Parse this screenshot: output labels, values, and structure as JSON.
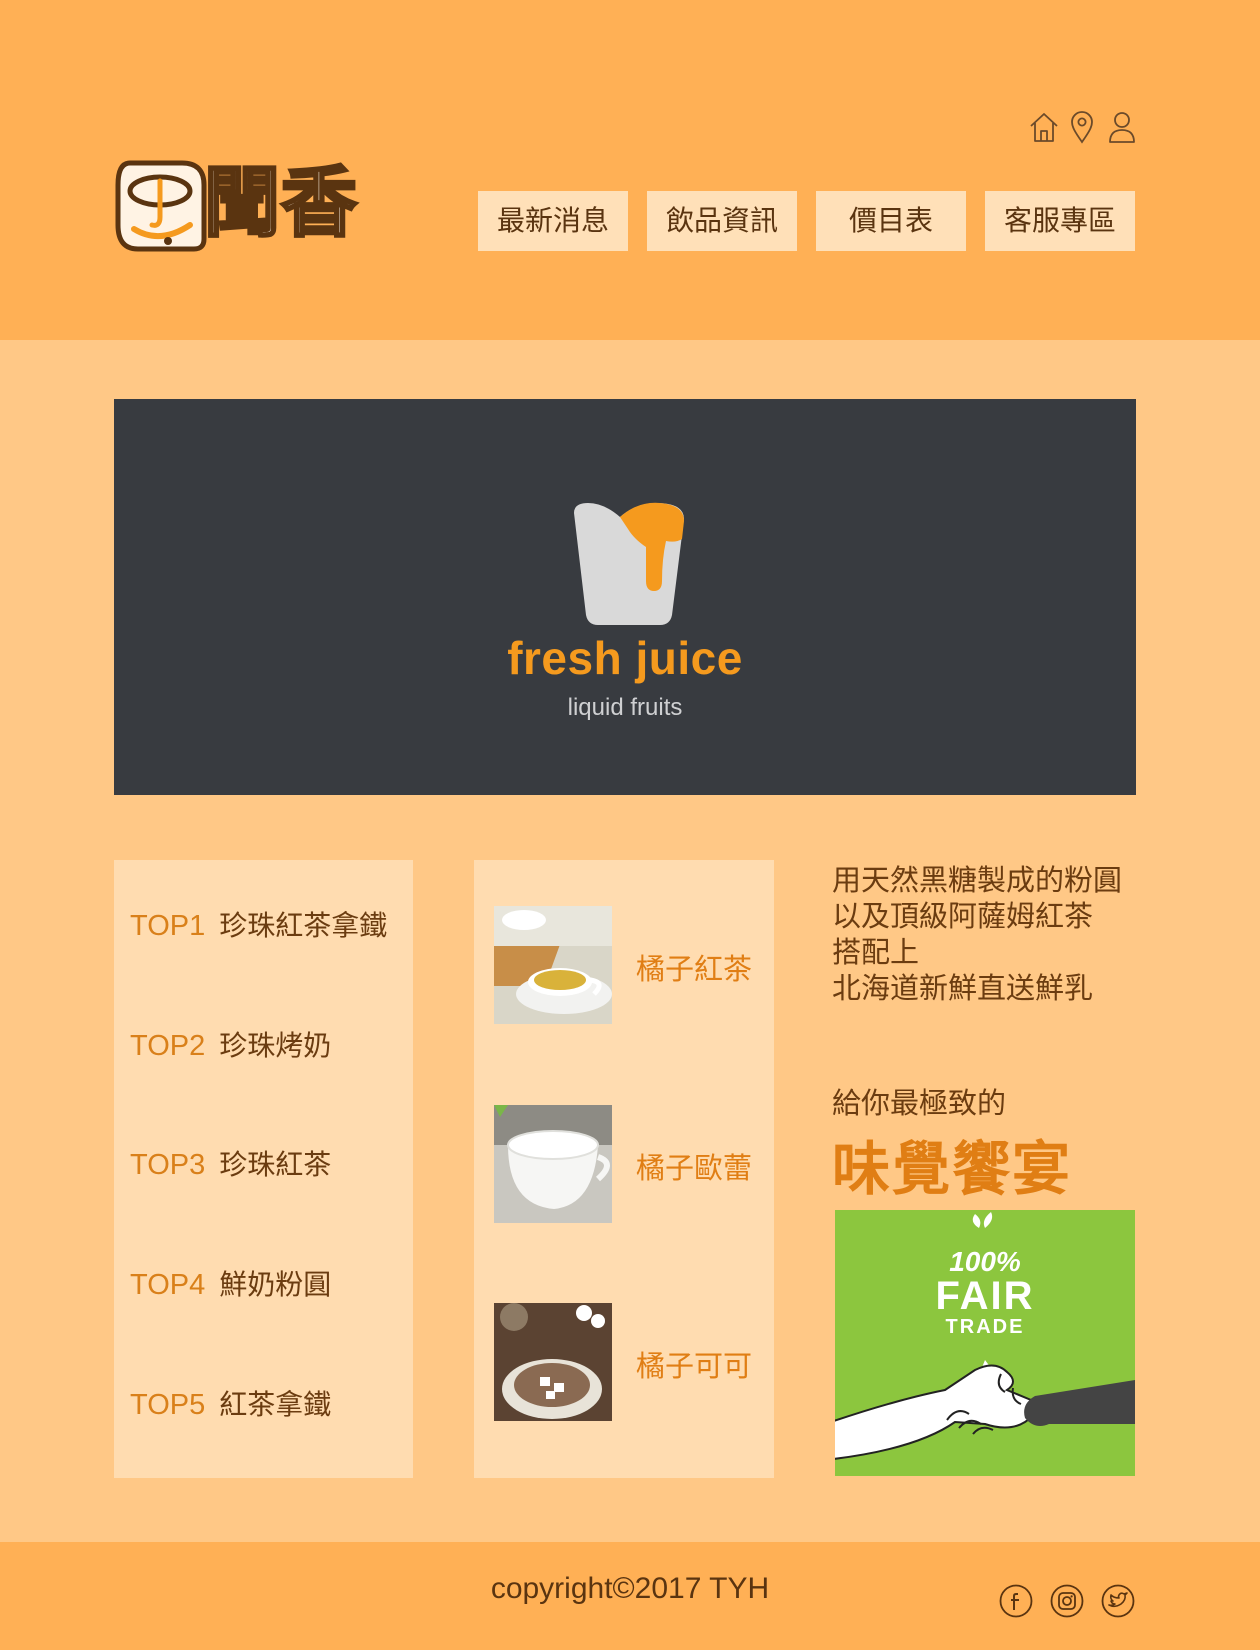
{
  "brand": {
    "logo_text": "聞香",
    "primary_color": "#ffb055",
    "background_color": "#ffc886",
    "panel_color": "#ffdcb0",
    "accent_color": "#e07e14",
    "text_color": "#6b3c10"
  },
  "header": {
    "icons": [
      "home-icon",
      "location-pin-icon",
      "user-icon"
    ],
    "nav": [
      "最新消息",
      "飲品資訊",
      "價目表",
      "客服專區"
    ]
  },
  "banner": {
    "title": "fresh juice",
    "subtitle": "liquid fruits"
  },
  "top_list": [
    {
      "rank": "TOP1",
      "name": "珍珠紅茶拿鐵"
    },
    {
      "rank": "TOP2",
      "name": "珍珠烤奶"
    },
    {
      "rank": "TOP3",
      "name": "珍珠紅茶"
    },
    {
      "rank": "TOP4",
      "name": "鮮奶粉圓"
    },
    {
      "rank": "TOP5",
      "name": "紅茶拿鐵"
    }
  ],
  "drinks": [
    {
      "name": "橘子紅茶",
      "image": "tea-cup-photo"
    },
    {
      "name": "橘子歐蕾",
      "image": "milk-cup-photo"
    },
    {
      "name": "橘子可可",
      "image": "cocoa-cup-photo"
    }
  ],
  "promo": {
    "lines": [
      "用天然黑糖製成的粉圓",
      "以及頂級阿薩姆紅茶",
      "搭配上",
      "北海道新鮮直送鮮乳"
    ],
    "sub": "給你最極致的",
    "highlight": "味覺饗宴"
  },
  "fair_trade": {
    "line1": "100%",
    "line2": "FAIR",
    "line3": "TRADE"
  },
  "footer": {
    "copyright": "copyright©2017 TYH",
    "social": [
      "facebook-icon",
      "instagram-icon",
      "twitter-icon"
    ]
  }
}
